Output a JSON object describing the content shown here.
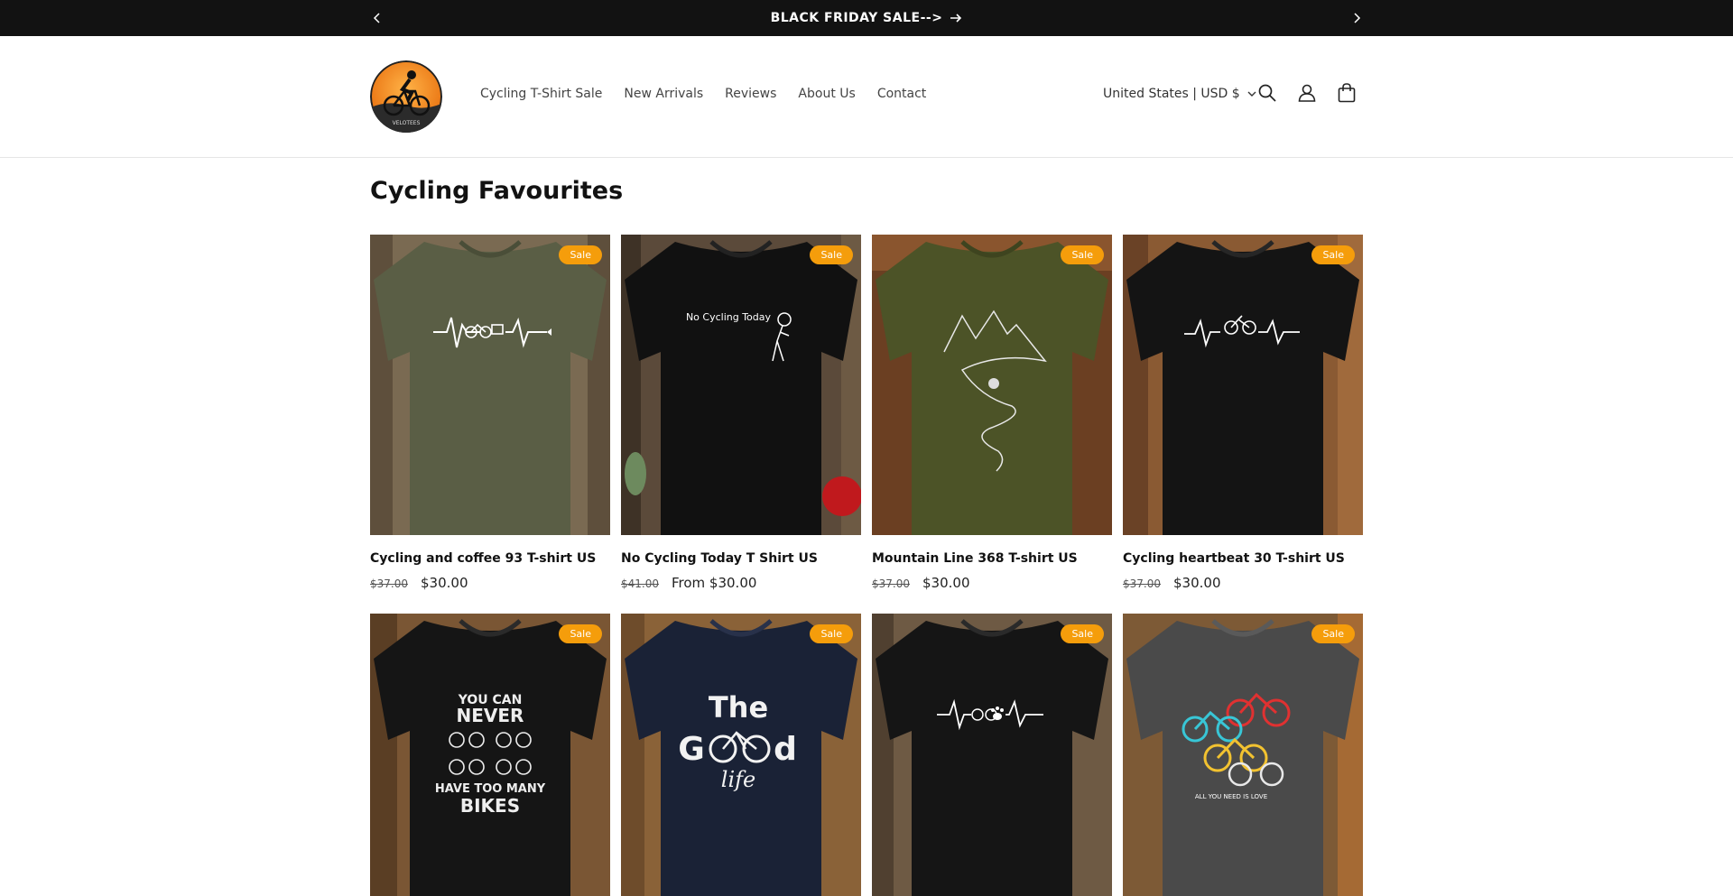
{
  "announcement": {
    "text": "BLACK FRIDAY SALE-->"
  },
  "header": {
    "logo_text": "VELOTEES",
    "nav": [
      "Cycling T-Shirt Sale",
      "New Arrivals",
      "Reviews",
      "About Us",
      "Contact"
    ],
    "country": "United States | USD $"
  },
  "section": {
    "title": "Cycling Favourites"
  },
  "badge_label": "Sale",
  "products": [
    {
      "name": "Cycling and coffee 93 T-shirt US",
      "old_price": "$37.00",
      "price": "$30.00",
      "shirt_color": "#5a5e45",
      "bg": "#7a6a52"
    },
    {
      "name": "No Cycling Today T Shirt US",
      "old_price": "$41.00",
      "price": "From $30.00",
      "shirt_color": "#111111",
      "bg": "#5b4a3a"
    },
    {
      "name": "Mountain Line 368 T-shirt US",
      "old_price": "$37.00",
      "price": "$30.00",
      "shirt_color": "#4c5327",
      "bg": "#6b3f22"
    },
    {
      "name": "Cycling heartbeat 30 T-shirt US",
      "old_price": "$37.00",
      "price": "$30.00",
      "shirt_color": "#141414",
      "bg": "#8a5a33"
    },
    {
      "name": "",
      "old_price": "",
      "price": "",
      "shirt_color": "#151515",
      "bg": "#7a5634"
    },
    {
      "name": "",
      "old_price": "",
      "price": "",
      "shirt_color": "#1a2236",
      "bg": "#8a6238"
    },
    {
      "name": "",
      "old_price": "",
      "price": "",
      "shirt_color": "#151515",
      "bg": "#6e5a44"
    },
    {
      "name": "",
      "old_price": "",
      "price": "",
      "shirt_color": "#4a4a4a",
      "bg": "#7d5a36"
    }
  ],
  "shirt_prints": {
    "p1": "No Cycling Today",
    "p4_line1": "YOU CAN",
    "p4_line2": "NEVER",
    "p4_line3": "HAVE TOO MANY",
    "p4_line4": "BIKES",
    "p5_line1": "The",
    "p5_line2a": "G",
    "p5_line2b": "d",
    "p5_line3": "life",
    "p7": "ALL YOU NEED IS LOVE"
  }
}
